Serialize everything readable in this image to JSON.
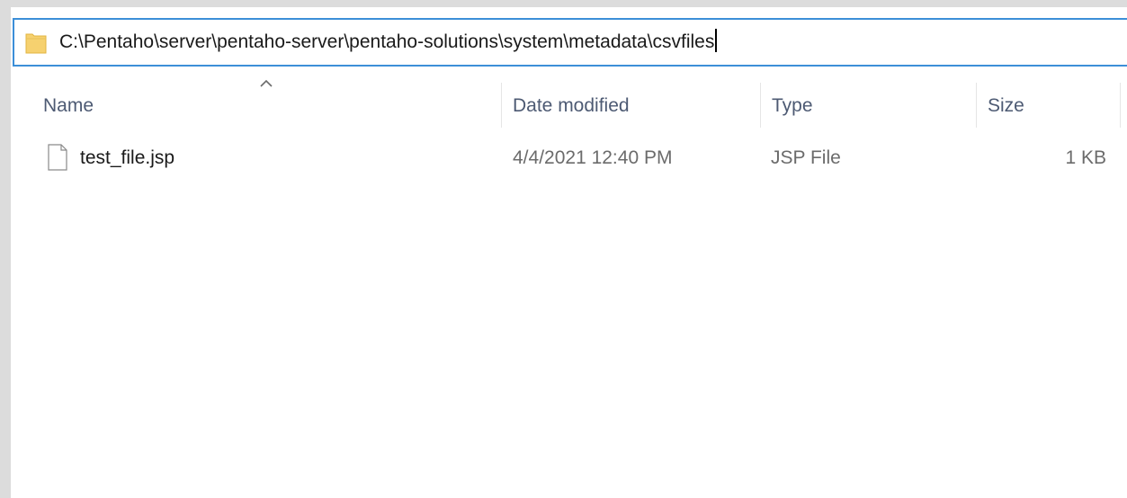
{
  "address_bar": {
    "path": "C:\\Pentaho\\server\\pentaho-server\\pentaho-solutions\\system\\metadata\\csvfiles",
    "icon": "folder-icon"
  },
  "columns": {
    "name": "Name",
    "date_modified": "Date modified",
    "type": "Type",
    "size": "Size",
    "sort_icon": "chevron-up-icon"
  },
  "files": [
    {
      "name": "test_file.jsp",
      "date_modified": "4/4/2021 12:40 PM",
      "type": "JSP File",
      "size": "1 KB",
      "icon": "file-icon"
    }
  ],
  "colors": {
    "focus_border": "#3c8fd8",
    "folder": "#f6d16f",
    "header_text": "#4d5a73",
    "secondary_text": "#6b6b6b"
  }
}
